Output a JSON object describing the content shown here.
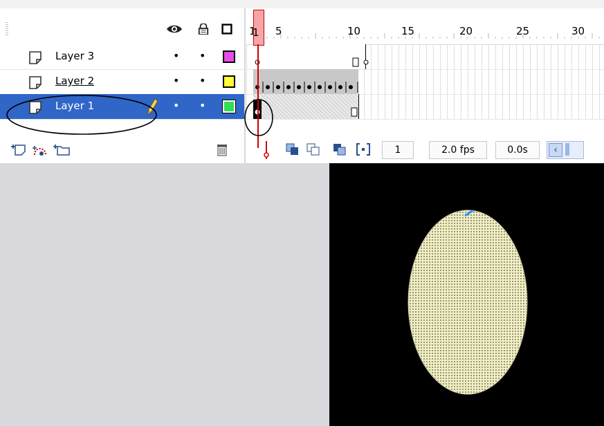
{
  "timeline": {
    "header_icons": [
      "eye-icon",
      "lock-icon",
      "outline-icon"
    ],
    "layers": [
      {
        "name": "Layer 3",
        "visible_marker": "•",
        "lock_marker": "•",
        "color": "#e64de6",
        "selected": false
      },
      {
        "name": "Layer 2",
        "visible_marker": "•",
        "lock_marker": "•",
        "color": "#ffff3a",
        "selected": false
      },
      {
        "name": "Layer 1",
        "visible_marker": "•",
        "lock_marker": "•",
        "color": "#33dd55",
        "selected": true
      }
    ],
    "ruler_numbers": [
      "1",
      "5",
      "10",
      "15",
      "20",
      "25",
      "30"
    ],
    "footer": {
      "current_frame": "1",
      "frame_rate": "2.0 fps",
      "elapsed_time": "0.0s"
    },
    "toolbar_icons": [
      "insert-layer-icon",
      "add-motion-guide-icon",
      "insert-folder-icon",
      "trash-icon"
    ]
  },
  "stage": {
    "background": "#000000",
    "pasteboard": "#d9d8dc",
    "ellipse_fill": "#f2efc0"
  }
}
